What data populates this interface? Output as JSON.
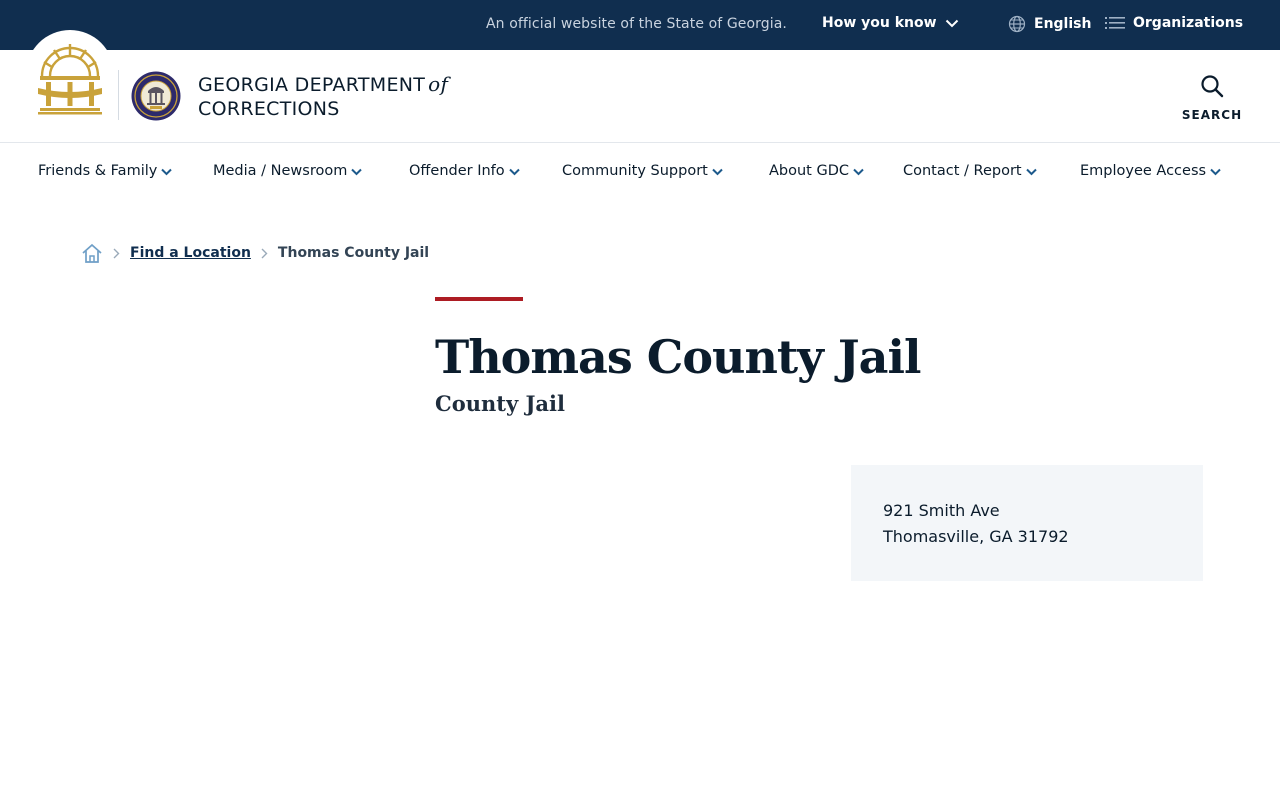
{
  "topbar": {
    "official_text": "An official website of the State of Georgia.",
    "how_you_know": "How you know",
    "language": "English",
    "organizations": "Organizations"
  },
  "header": {
    "brand_line1": "GEORGIA DEPARTMENT",
    "brand_of": "of",
    "brand_line2": "CORRECTIONS",
    "search_label": "SEARCH"
  },
  "nav": {
    "items": [
      {
        "label": "Friends & Family"
      },
      {
        "label": "Media / Newsroom"
      },
      {
        "label": "Offender Info"
      },
      {
        "label": "Community Support"
      },
      {
        "label": "About GDC"
      },
      {
        "label": "Contact / Report"
      },
      {
        "label": "Employee Access"
      }
    ]
  },
  "breadcrumb": {
    "link": "Find a Location",
    "current": "Thomas County Jail"
  },
  "page": {
    "title": "Thomas County Jail",
    "subtitle": "County Jail"
  },
  "address": {
    "line1": "921 Smith Ave",
    "line2": "Thomasville, GA 31792"
  },
  "colors": {
    "topbar_bg": "#102e4f",
    "accent_red": "#ad1c23",
    "seal_gold": "#c9a23a",
    "card_bg": "#f3f6f9",
    "nav_chevron": "#1d5a8c"
  },
  "icons": {
    "how_you_know_chevron": "chevron-down-icon",
    "language": "globe-icon",
    "organizations": "list-icon",
    "search": "search-icon",
    "breadcrumb_home": "home-icon",
    "breadcrumb_separator": "chevron-right-icon"
  }
}
